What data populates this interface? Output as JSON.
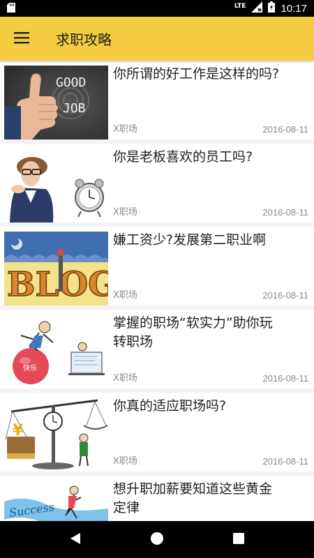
{
  "status_bar": {
    "time": "10:17",
    "network": "LTE"
  },
  "app_bar": {
    "title": "求职攻略",
    "accent_color": "#f4cc3f"
  },
  "articles": [
    {
      "title": "你所谓的好工作是这样的吗?",
      "source": "X职场",
      "date": "2016-08-11"
    },
    {
      "title": "你是老板喜欢的员工吗?",
      "source": "X职场",
      "date": "2016-08-11"
    },
    {
      "title": "嫌工资少?发展第二职业啊",
      "source": "X职场",
      "date": "2016-08-11"
    },
    {
      "title": "掌握的职场“软实力”助你玩转职场",
      "source": "X职场",
      "date": "2016-08-11"
    },
    {
      "title": "你真的适应职场吗?",
      "source": "X职场",
      "date": "2016-08-11"
    },
    {
      "title": "想升职加薪要知道这些黄金定律",
      "source": "",
      "date": ""
    }
  ],
  "thumbnails": {
    "good_job": [
      "GOOD",
      "JOB"
    ],
    "blog": "BLOG",
    "ball_label": "快乐",
    "success": "Success"
  }
}
